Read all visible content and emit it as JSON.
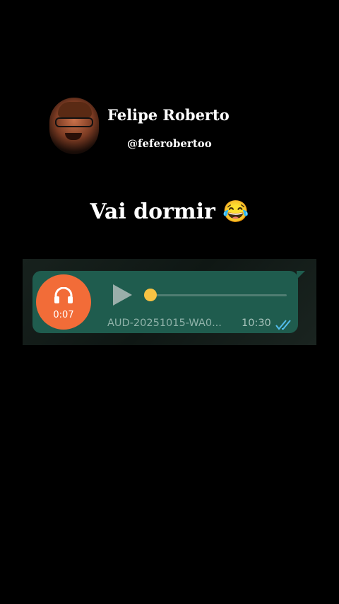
{
  "profile": {
    "name": "Felipe Roberto",
    "handle": "@feferobertoo"
  },
  "caption": {
    "text": "Vai dormir",
    "emoji": "😂"
  },
  "audio_message": {
    "duration": "0:07",
    "filename": "AUD-20251015-WA0...",
    "time": "10:30",
    "progress": 0.0,
    "status": "read",
    "bubble_color": "#1f5c4e",
    "icon_bg_color": "#f26c38",
    "thumb_color": "#f8c243",
    "ticks_color": "#53bdeb"
  }
}
